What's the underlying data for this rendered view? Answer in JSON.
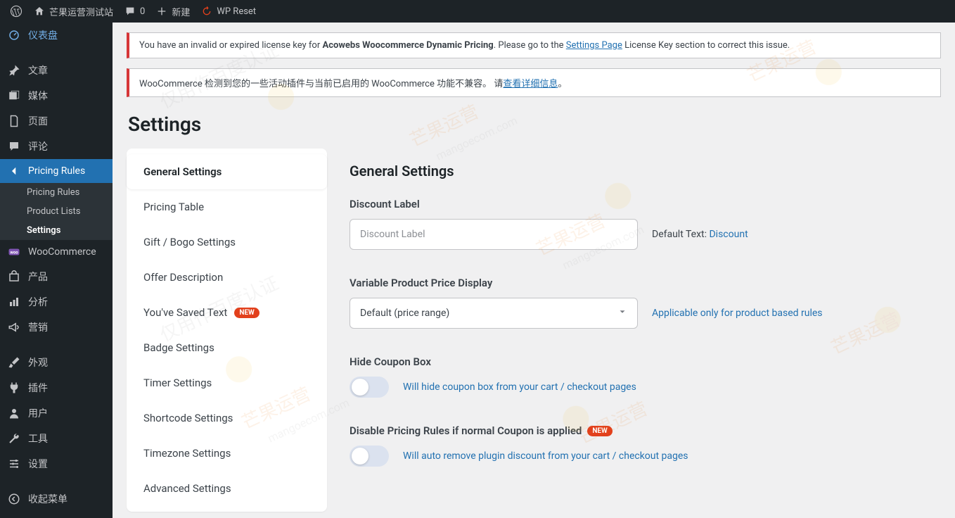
{
  "adminbar": {
    "site_title": "芒果运营测试站",
    "comments_count": "0",
    "new_label": "新建",
    "wpreset_label": "WP Reset"
  },
  "menu": {
    "dashboard": "仪表盘",
    "posts": "文章",
    "media": "媒体",
    "pages": "页面",
    "comments": "评论",
    "pricing_rules": "Pricing Rules",
    "sub_pricing_rules": "Pricing Rules",
    "sub_product_lists": "Product Lists",
    "sub_settings": "Settings",
    "woocommerce": "WooCommerce",
    "products": "产品",
    "analytics": "分析",
    "marketing": "营销",
    "appearance": "外观",
    "plugins": "插件",
    "users": "用户",
    "tools": "工具",
    "settings": "设置",
    "collapse": "收起菜单"
  },
  "notices": {
    "license_pre": "You have an invalid or expired license key for ",
    "license_product": "Acowebs Woocommerce Dynamic Pricing",
    "license_mid": ". Please go to the ",
    "license_link": "Settings Page",
    "license_post": " License Key section to correct this issue.",
    "woo_pre": "WooCommerce 检测到您的一些活动插件与当前已启用的 WooCommerce 功能不兼容。 请",
    "woo_link": "查看详细信息",
    "woo_post": "。"
  },
  "page": {
    "title": "Settings"
  },
  "tabs": {
    "general": "General Settings",
    "pricing_table": "Pricing Table",
    "gift_bogo": "Gift / Bogo Settings",
    "offer_desc": "Offer Description",
    "saved_text": "You've Saved Text",
    "badge": "Badge Settings",
    "timer": "Timer Settings",
    "shortcode": "Shortcode Settings",
    "timezone": "Timezone Settings",
    "advanced": "Advanced Settings",
    "new_badge": "NEW"
  },
  "form": {
    "section_title": "General Settings",
    "discount_label": "Discount Label",
    "discount_placeholder": "Discount Label",
    "discount_default_pre": "Default Text: ",
    "discount_default_val": "Discount",
    "variable_label": "Variable Product Price Display",
    "variable_value": "Default (price range)",
    "variable_help": "Applicable only for product based rules",
    "hide_coupon_label": "Hide Coupon Box",
    "hide_coupon_help": "Will hide coupon box from your cart / checkout pages",
    "disable_rules_label": "Disable Pricing Rules if normal Coupon is applied",
    "disable_rules_help": "Will auto remove plugin discount from your cart / checkout pages",
    "new_badge": "NEW"
  },
  "watermark": {
    "brand": "芒果运营",
    "url": "mangoecom.com",
    "cert": "仅用作百度认证"
  }
}
